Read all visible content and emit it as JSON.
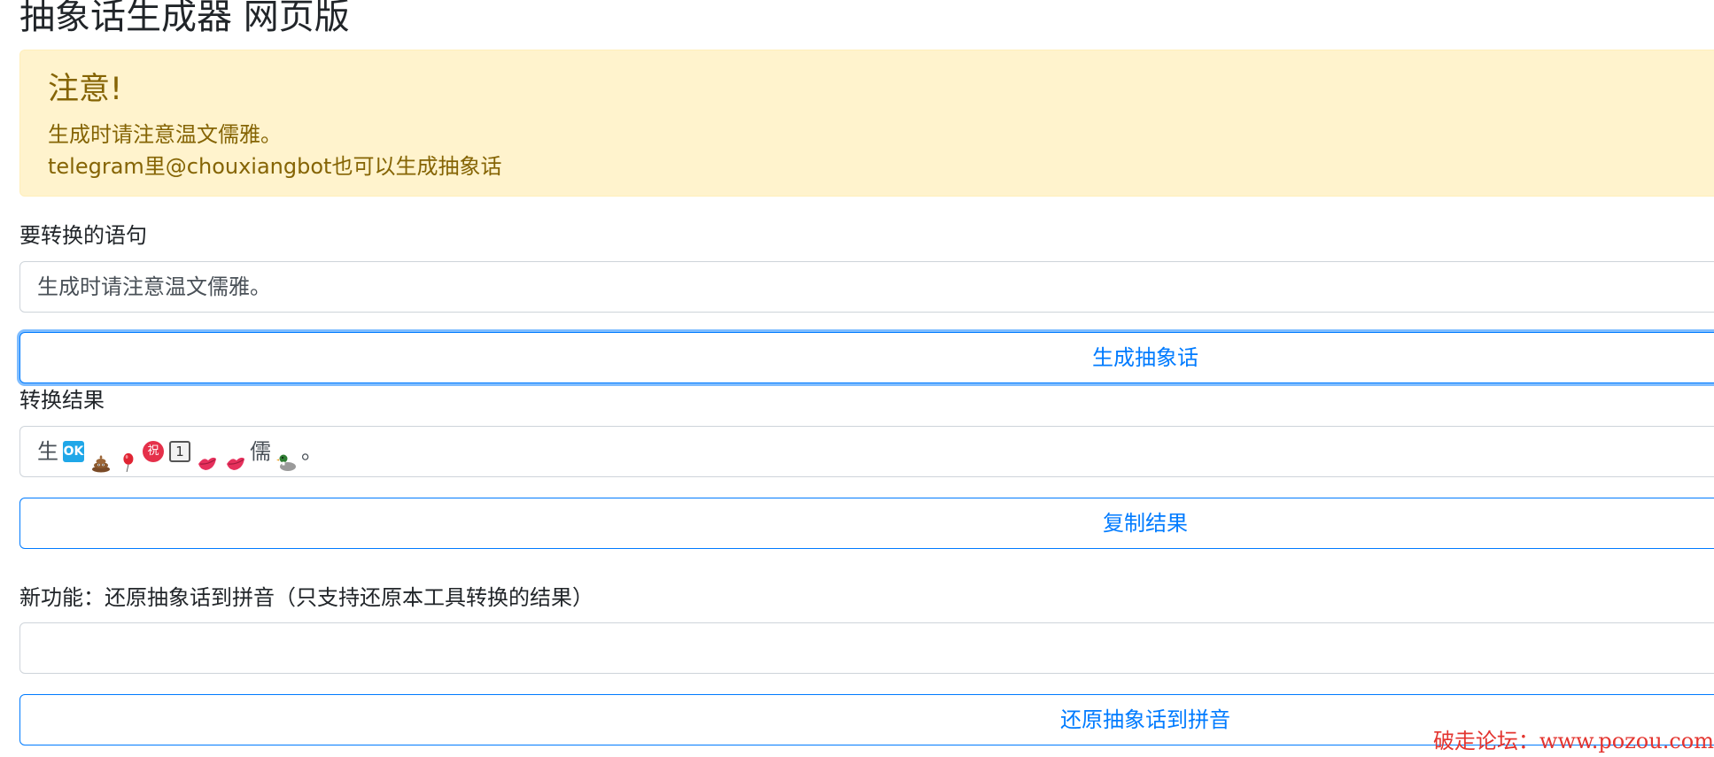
{
  "page": {
    "title": "抽象话生成器 网页版"
  },
  "alert": {
    "heading": "注意!",
    "line1": "生成时请注意温文儒雅。",
    "line2": "telegram里@chouxiangbot也可以生成抽象话"
  },
  "input_section": {
    "label": "要转换的语句",
    "value": "生成时请注意温文儒雅。"
  },
  "generate_button": {
    "label": "生成抽象话"
  },
  "result_section": {
    "label": "转换结果",
    "tokens": [
      {
        "type": "text",
        "value": "生"
      },
      {
        "type": "emoji",
        "icon": "ok-button-icon",
        "glyph": "OK"
      },
      {
        "type": "emoji",
        "icon": "pile-of-poo-icon"
      },
      {
        "type": "emoji",
        "icon": "red-balloon-icon"
      },
      {
        "type": "emoji",
        "icon": "zhu-congratulations-icon",
        "glyph": "祝"
      },
      {
        "type": "emoji",
        "icon": "keycap-one-icon",
        "glyph": "1"
      },
      {
        "type": "emoji",
        "icon": "kiss-mark-icon"
      },
      {
        "type": "emoji",
        "icon": "kiss-mark-icon"
      },
      {
        "type": "text",
        "value": "儒"
      },
      {
        "type": "emoji",
        "icon": "duck-icon"
      },
      {
        "type": "text",
        "value": "。"
      }
    ]
  },
  "copy_button": {
    "label": "复制结果"
  },
  "restore_section": {
    "label": "新功能：还原抽象话到拼音（只支持还原本工具转换的结果）",
    "value": ""
  },
  "restore_button": {
    "label": "还原抽象话到拼音"
  },
  "watermark": {
    "text": "破走论坛：www.pozou.com"
  },
  "colors": {
    "alert_bg": "#fff3cd",
    "alert_text": "#856404",
    "primary": "#007bff",
    "watermark": "#e3342f"
  }
}
